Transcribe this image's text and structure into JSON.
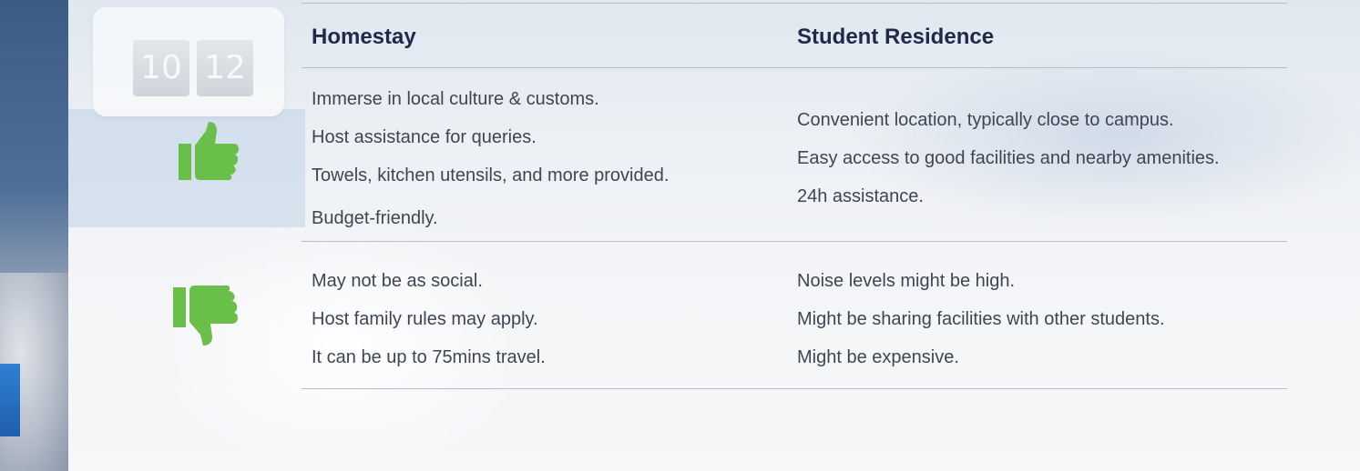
{
  "background": {
    "clock_digits": [
      "10",
      "12"
    ]
  },
  "columns": {
    "homestay": "Homestay",
    "residence": "Student Residence"
  },
  "pros": {
    "icon": "thumbs-up-icon",
    "homestay": [
      "Immerse in local culture & customs.",
      "Host assistance for queries.",
      "Towels, kitchen utensils, and more provided.",
      "Budget-friendly."
    ],
    "residence": [
      "Convenient location, typically close to campus.",
      "Easy access to good facilities and nearby amenities.",
      "24h assistance."
    ]
  },
  "cons": {
    "icon": "thumbs-down-icon",
    "homestay": [
      "May not be as social.",
      "Host family rules may apply.",
      "It can be up to 75mins travel."
    ],
    "residence": [
      "Noise levels might be high.",
      "Might be sharing facilities with other students.",
      "Might be expensive."
    ]
  },
  "colors": {
    "accent_green": "#6abf4b",
    "title": "#1e2a47",
    "text": "#3f4552"
  }
}
